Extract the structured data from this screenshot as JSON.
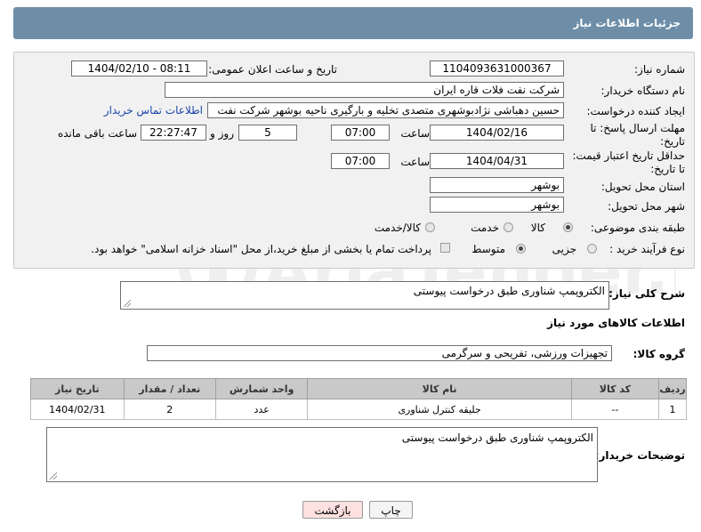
{
  "header": {
    "title": "جزئیات اطلاعات نیاز"
  },
  "form": {
    "need_number": {
      "label": "شماره نیاز:",
      "value": "1104093631000367"
    },
    "announce_datetime": {
      "label": "تاریخ و ساعت اعلان عمومی:",
      "value": "1404/02/10 - 08:11"
    },
    "buyer_org": {
      "label": "نام دستگاه خریدار:",
      "value": "شرکت نفت فلات قاره ایران"
    },
    "requester": {
      "label": "ایجاد کننده درخواست:",
      "value": "حسین دهباشی نژادبوشهری متصدی تخلیه و بارگیری ناحیه بوشهر شرکت نفت",
      "contact_link": "اطلاعات تماس خریدار"
    },
    "reply_deadline": {
      "label_line1": "مهلت ارسال پاسخ: تا",
      "label_line2": "تاریخ:",
      "date": "1404/02/16",
      "time_label": "ساعت",
      "time": "07:00",
      "days": "5",
      "days_label": "روز و",
      "remaining": "22:27:47",
      "remaining_label": "ساعت باقی مانده"
    },
    "price_validity": {
      "label_line1": "حداقل تاریخ اعتبار قیمت:",
      "label_line2": "تا تاریخ:",
      "date": "1404/04/31",
      "time_label": "ساعت",
      "time": "07:00"
    },
    "delivery_province": {
      "label": "استان محل تحویل:",
      "value": "بوشهر"
    },
    "delivery_city": {
      "label": "شهر محل تحویل:",
      "value": "بوشهر"
    },
    "category": {
      "label": "طبقه بندی موضوعی:",
      "options": [
        "کالا",
        "خدمت",
        "کالا/خدمت"
      ],
      "selected": "کالا"
    },
    "process_type": {
      "label": "نوع فرآیند خرید :",
      "options": [
        "جزیی",
        "متوسط"
      ],
      "selected": "متوسط",
      "payment_note": "پرداخت تمام یا بخشی از مبلغ خرید،از محل \"اسناد خزانه اسلامی\" خواهد بود."
    }
  },
  "description": {
    "label": "شرح کلی نیاز:",
    "value": "الکتروپمپ شناوری طبق درخواست پیوستی"
  },
  "goods_section": {
    "title": "اطلاعات کالاهای مورد نیاز"
  },
  "goods_group": {
    "label": "گروه کالا:",
    "value": "تجهیزات ورزشی، تفریحی و سرگرمی"
  },
  "table": {
    "headers": [
      "ردیف",
      "کد کالا",
      "نام کالا",
      "واحد شمارش",
      "تعداد / مقدار",
      "تاریخ نیاز"
    ],
    "rows": [
      [
        "1",
        "--",
        "جلیقه کنترل شناوری",
        "عدد",
        "2",
        "1404/02/31"
      ]
    ]
  },
  "buyer_notes": {
    "label": "توضیحات خریدار:",
    "value": "الکتروپمپ شناوری طبق درخواست پیوستی"
  },
  "buttons": {
    "print": "چاپ",
    "back": "بازگشت"
  },
  "watermark": {
    "text": "AriaTender.neT"
  }
}
